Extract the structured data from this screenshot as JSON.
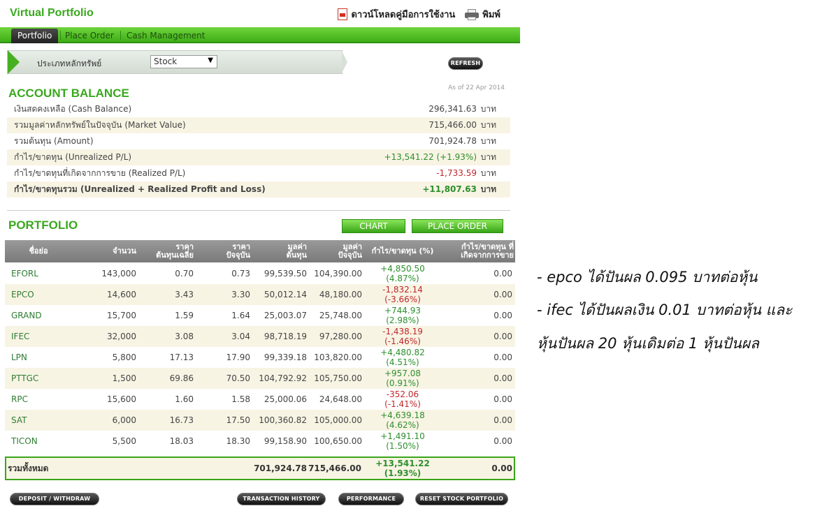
{
  "header": {
    "app_title": "Virtual Portfolio",
    "download_manual": "ดาวน์โหลดคู่มือการใช้งาน",
    "print": "พิมพ์"
  },
  "nav": {
    "tabs": [
      {
        "label": "Portfolio",
        "active": true
      },
      {
        "label": "Place Order",
        "active": false
      },
      {
        "label": "Cash Management",
        "active": false
      }
    ]
  },
  "filter": {
    "label": "ประเภทหลักทรัพย์",
    "selected": "Stock",
    "refresh_label": "REFRESH"
  },
  "account_balance": {
    "title": "ACCOUNT BALANCE",
    "as_of": "As of 22 Apr 2014",
    "unit": "บาท",
    "rows": [
      {
        "label": "เงินสดคงเหลือ (Cash Balance)",
        "value": "296,341.63"
      },
      {
        "label": "รวมมูลค่าหลักทรัพย์ในปัจจุบัน (Market Value)",
        "value": "715,466.00"
      },
      {
        "label": "รวมต้นทุน (Amount)",
        "value": "701,924.78"
      },
      {
        "label": "กำไร/ขาดทุน (Unrealized P/L)",
        "value": "+13,541.22 (+1.93%)"
      },
      {
        "label": "กำไร/ขาดทุนที่เกิดจากการขาย (Realized P/L)",
        "value": "-1,733.59"
      },
      {
        "label": "กำไร/ขาดทุนรวม (Unrealized + Realized Profit and Loss)",
        "value": "+11,807.63"
      }
    ]
  },
  "portfolio": {
    "title": "PORTFOLIO",
    "chart_button": "CHART",
    "place_order_button": "PLACE ORDER",
    "columns": {
      "symbol": "ชื่อย่อ",
      "volume": "จำนวน",
      "avg_cost": "ราคา\nต้นทุนเฉลี่ย",
      "price": "ราคา\nปัจจุบัน",
      "cost_value": "มูลค่า\nต้นทุน",
      "market_value": "มูลค่า\nปัจจุบัน",
      "unrealized": "กำไร/ขาดทุน (%)",
      "realized": "กำไร/ขาดทุน ที่\nเกิดจากการขาย"
    },
    "rows": [
      {
        "symbol": "EFORL",
        "volume": "143,000",
        "avg_cost": "0.70",
        "price": "0.73",
        "cost_value": "99,539.50",
        "market_value": "104,390.00",
        "pl": "+4,850.50",
        "pl_pct": "(4.87%)",
        "realized": "0.00"
      },
      {
        "symbol": "EPCO",
        "volume": "14,600",
        "avg_cost": "3.43",
        "price": "3.30",
        "cost_value": "50,012.14",
        "market_value": "48,180.00",
        "pl": "-1,832.14",
        "pl_pct": "(-3.66%)",
        "realized": "0.00"
      },
      {
        "symbol": "GRAND",
        "volume": "15,700",
        "avg_cost": "1.59",
        "price": "1.64",
        "cost_value": "25,003.07",
        "market_value": "25,748.00",
        "pl": "+744.93",
        "pl_pct": "(2.98%)",
        "realized": "0.00"
      },
      {
        "symbol": "IFEC",
        "volume": "32,000",
        "avg_cost": "3.08",
        "price": "3.04",
        "cost_value": "98,718.19",
        "market_value": "97,280.00",
        "pl": "-1,438.19",
        "pl_pct": "(-1.46%)",
        "realized": "0.00"
      },
      {
        "symbol": "LPN",
        "volume": "5,800",
        "avg_cost": "17.13",
        "price": "17.90",
        "cost_value": "99,339.18",
        "market_value": "103,820.00",
        "pl": "+4,480.82",
        "pl_pct": "(4.51%)",
        "realized": "0.00"
      },
      {
        "symbol": "PTTGC",
        "volume": "1,500",
        "avg_cost": "69.86",
        "price": "70.50",
        "cost_value": "104,792.92",
        "market_value": "105,750.00",
        "pl": "+957.08",
        "pl_pct": "(0.91%)",
        "realized": "0.00"
      },
      {
        "symbol": "RPC",
        "volume": "15,600",
        "avg_cost": "1.60",
        "price": "1.58",
        "cost_value": "25,000.06",
        "market_value": "24,648.00",
        "pl": "-352.06",
        "pl_pct": "(-1.41%)",
        "realized": "0.00"
      },
      {
        "symbol": "SAT",
        "volume": "6,000",
        "avg_cost": "16.73",
        "price": "17.50",
        "cost_value": "100,360.82",
        "market_value": "105,000.00",
        "pl": "+4,639.18",
        "pl_pct": "(4.62%)",
        "realized": "0.00"
      },
      {
        "symbol": "TICON",
        "volume": "5,500",
        "avg_cost": "18.03",
        "price": "18.30",
        "cost_value": "99,158.90",
        "market_value": "100,650.00",
        "pl": "+1,491.10",
        "pl_pct": "(1.50%)",
        "realized": "0.00"
      }
    ],
    "total": {
      "label": "รวมทั้งหมด",
      "cost_value": "701,924.78",
      "market_value": "715,466.00",
      "pl": "+13,541.22",
      "pl_pct": "(1.93%)",
      "realized": "0.00"
    }
  },
  "footer_buttons": {
    "deposit": "DEPOSIT / WITHDRAW",
    "history": "TRANSACTION HISTORY",
    "performance": "PERFORMANCE",
    "reset": "RESET STOCK PORTFOLIO"
  },
  "notes": [
    "- epco ได้ปันผล 0.095 บาทต่อหุ้น",
    "- ifec ได้ปันผลเงิน 0.01 บาทต่อหุ้น และ",
    "หุ้นปันผล 20 หุ้นเดิมต่อ 1 หุ้นปันผล"
  ],
  "colors": {
    "brand_green": "#3aa81e",
    "positive": "#2d8f2d",
    "negative": "#c0262b"
  }
}
